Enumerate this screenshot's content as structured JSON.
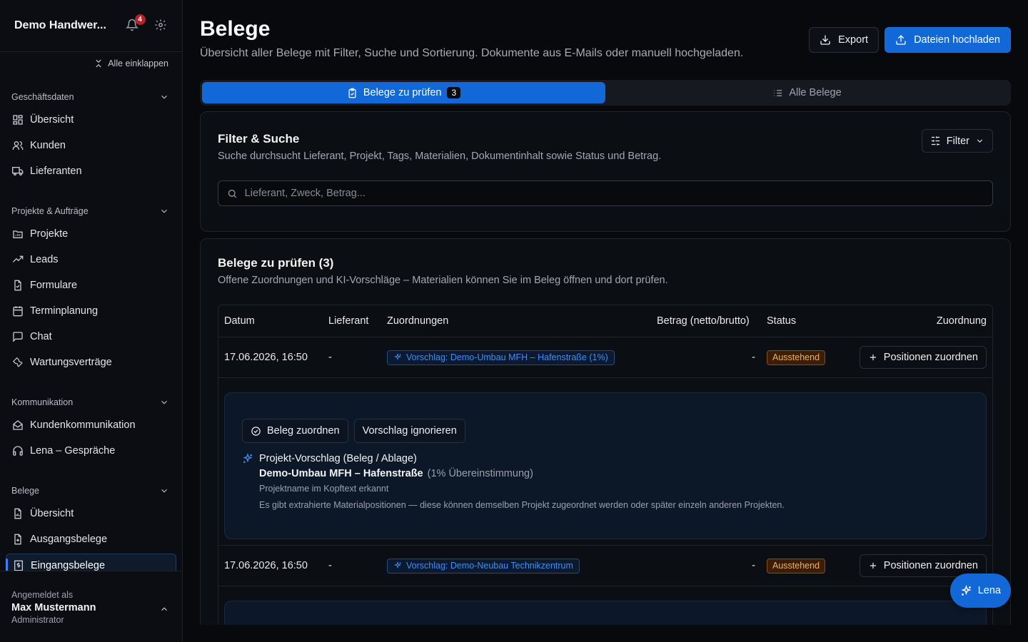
{
  "sidebar": {
    "company": "Demo Handwer...",
    "notifications_count": "4",
    "collapse_all": "Alle einklappen",
    "sections": [
      {
        "title": "Geschäftsdaten",
        "items": [
          "Übersicht",
          "Kunden",
          "Lieferanten"
        ]
      },
      {
        "title": "Projekte & Aufträge",
        "items": [
          "Projekte",
          "Leads",
          "Formulare",
          "Terminplanung",
          "Chat",
          "Wartungsverträge"
        ]
      },
      {
        "title": "Kommunikation",
        "items": [
          "Kundenkommunikation",
          "Lena – Gespräche"
        ]
      },
      {
        "title": "Belege",
        "items": [
          "Übersicht",
          "Ausgangsbelege",
          "Eingangsbelege"
        ]
      }
    ],
    "footer": {
      "logged_in_as": "Angemeldet als",
      "user_name": "Max Mustermann",
      "role": "Administrator"
    }
  },
  "header": {
    "title": "Belege",
    "subtitle": "Übersicht aller Belege mit Filter, Suche und Sortierung. Dokumente aus E-Mails oder manuell hochgeladen.",
    "export_label": "Export",
    "upload_label": "Dateien hochladen"
  },
  "tabs": [
    {
      "label": "Belege zu prüfen",
      "count": "3"
    },
    {
      "label": "Alle Belege"
    }
  ],
  "filter": {
    "title": "Filter & Suche",
    "description": "Suche durchsucht Lieferant, Projekt, Tags, Materialien, Dokumentinhalt sowie Status und Betrag.",
    "button_label": "Filter",
    "search_placeholder": "Lieferant, Zweck, Betrag..."
  },
  "review": {
    "title": "Belege zu prüfen (3)",
    "description": "Offene Zuordnungen und KI-Vorschläge – Materialien können Sie im Beleg öffnen und dort prüfen.",
    "columns": [
      "Datum",
      "Lieferant",
      "Zuordnungen",
      "Betrag (netto/brutto)",
      "Status",
      "Zuordnung"
    ],
    "rows": [
      {
        "date": "17.06.2026, 16:50",
        "supplier": "-",
        "suggestion": "Vorschlag: Demo-Umbau MFH – Hafenstraße (1%)",
        "amount": "-",
        "status": "Ausstehend",
        "action": "Positionen zuordnen"
      },
      {
        "date": "17.06.2026, 16:50",
        "supplier": "-",
        "suggestion": "Vorschlag: Demo-Neubau Technikzentrum",
        "amount": "-",
        "status": "Ausstehend",
        "action": "Positionen zuordnen"
      }
    ],
    "expanded": {
      "assign_label": "Beleg zuordnen",
      "ignore_label": "Vorschlag ignorieren",
      "heading": "Projekt-Vorschlag (Beleg / Ablage)",
      "project": "Demo-Umbau MFH – Hafenstraße",
      "match": "(1% Übereinstimmung)",
      "reason": "Projektname im Kopftext erkannt",
      "note": "Es gibt extrahierte Materialpositionen — diese können demselben Projekt zugeordnet werden oder später einzeln anderen Projekten."
    }
  },
  "assistant": {
    "label": "Lena"
  },
  "colors": {
    "accent": "#1268d6",
    "pending": "#f2b06b",
    "badge": "#b4232c"
  }
}
